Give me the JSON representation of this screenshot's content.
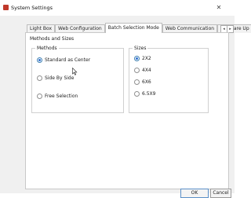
{
  "window": {
    "title": "System Settings",
    "close_glyph": "✕"
  },
  "tabs": [
    {
      "label": "Light Box",
      "active": false
    },
    {
      "label": "Web Configuration",
      "active": false
    },
    {
      "label": "Batch Selection Mode",
      "active": true
    },
    {
      "label": "Web Communication",
      "active": false
    },
    {
      "label": "Software Up",
      "active": false
    }
  ],
  "tab_scroll": {
    "left_glyph": "◂",
    "right_glyph": "▸"
  },
  "panel": {
    "title": "Methods and Sizes",
    "methods": {
      "label": "Methods",
      "options": [
        {
          "label": "Standard as Center",
          "checked": true
        },
        {
          "label": "Side By Side",
          "checked": false
        },
        {
          "label": "Free Selection",
          "checked": false
        }
      ]
    },
    "sizes": {
      "label": "Sizes",
      "options": [
        {
          "label": "2X2",
          "checked": true
        },
        {
          "label": "4X4",
          "checked": false
        },
        {
          "label": "6X6",
          "checked": false
        },
        {
          "label": "6.5X9",
          "checked": false
        }
      ]
    }
  },
  "buttons": {
    "ok": "OK",
    "cancel": "Cancel"
  },
  "colors": {
    "accent": "#2f6fd1",
    "app_icon": "#c0392b"
  },
  "icons": {
    "app": "app-logo-icon",
    "close": "close-icon",
    "cursor": "mouse-cursor-icon"
  }
}
